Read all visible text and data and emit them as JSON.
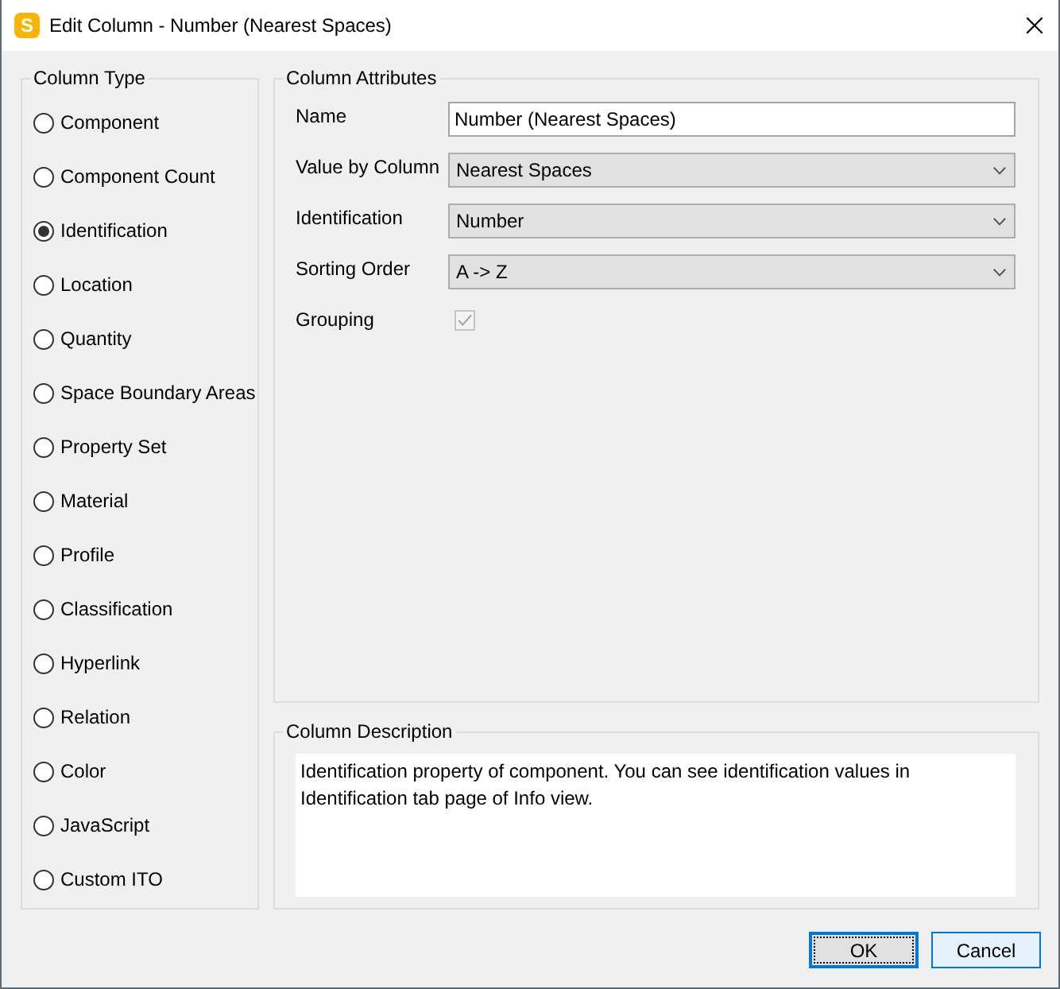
{
  "window": {
    "icon_letter": "S",
    "title": "Edit Column - Number (Nearest Spaces)"
  },
  "column_type": {
    "title": "Column Type",
    "options": [
      {
        "label": "Component",
        "selected": false
      },
      {
        "label": "Component Count",
        "selected": false
      },
      {
        "label": "Identification",
        "selected": true
      },
      {
        "label": "Location",
        "selected": false
      },
      {
        "label": "Quantity",
        "selected": false
      },
      {
        "label": "Space Boundary Areas",
        "selected": false
      },
      {
        "label": "Property Set",
        "selected": false
      },
      {
        "label": "Material",
        "selected": false
      },
      {
        "label": "Profile",
        "selected": false
      },
      {
        "label": "Classification",
        "selected": false
      },
      {
        "label": "Hyperlink",
        "selected": false
      },
      {
        "label": "Relation",
        "selected": false
      },
      {
        "label": "Color",
        "selected": false
      },
      {
        "label": "JavaScript",
        "selected": false
      },
      {
        "label": "Custom ITO",
        "selected": false
      }
    ]
  },
  "column_attributes": {
    "title": "Column Attributes",
    "fields": [
      {
        "kind": "text",
        "label": "Name",
        "value": "Number (Nearest Spaces)"
      },
      {
        "kind": "dropdown",
        "label": "Value by Column",
        "value": "Nearest Spaces"
      },
      {
        "kind": "dropdown",
        "label": "Identification",
        "value": "Number"
      },
      {
        "kind": "dropdown",
        "label": "Sorting Order",
        "value": "A -> Z"
      },
      {
        "kind": "checkbox",
        "label": "Grouping",
        "checked": true,
        "disabled": true
      }
    ]
  },
  "column_description": {
    "title": "Column Description",
    "text": "Identification property of component. You can see identification values in Identification tab page of Info view."
  },
  "buttons": [
    {
      "label": "OK",
      "focused": true,
      "hovered": false
    },
    {
      "label": "Cancel",
      "focused": false,
      "hovered": true
    }
  ]
}
